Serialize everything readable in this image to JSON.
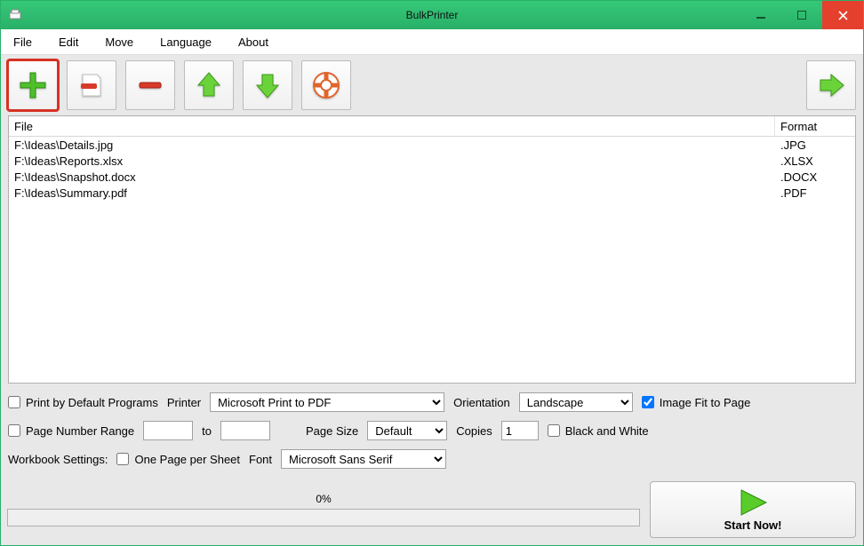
{
  "window": {
    "title": "BulkPrinter"
  },
  "menu": {
    "file": "File",
    "edit": "Edit",
    "move": "Move",
    "language": "Language",
    "about": "About"
  },
  "columns": {
    "file": "File",
    "format": "Format"
  },
  "rows": [
    {
      "file": "F:\\Ideas\\Details.jpg",
      "format": ".JPG"
    },
    {
      "file": "F:\\Ideas\\Reports.xlsx",
      "format": ".XLSX"
    },
    {
      "file": "F:\\Ideas\\Snapshot.docx",
      "format": ".DOCX"
    },
    {
      "file": "F:\\Ideas\\Summary.pdf",
      "format": ".PDF"
    }
  ],
  "settings": {
    "printDefault_label": "Print by Default Programs",
    "printDefault_checked": false,
    "printer_label": "Printer",
    "printer_value": "Microsoft Print to PDF",
    "orientation_label": "Orientation",
    "orientation_value": "Landscape",
    "imageFit_label": "Image Fit to Page",
    "imageFit_checked": true,
    "pageRange_label": "Page Number Range",
    "pageRange_checked": false,
    "pageRange_from": "",
    "pageRange_to_label": "to",
    "pageRange_to": "",
    "pageSize_label": "Page Size",
    "pageSize_value": "Default",
    "copies_label": "Copies",
    "copies_value": "1",
    "bw_label": "Black and White",
    "bw_checked": false,
    "workbook_label": "Workbook Settings:",
    "onepage_label": "One Page per Sheet",
    "onepage_checked": false,
    "font_label": "Font",
    "font_value": "Microsoft Sans Serif"
  },
  "progress": {
    "percent": "0%"
  },
  "start": {
    "label": "Start Now!"
  }
}
